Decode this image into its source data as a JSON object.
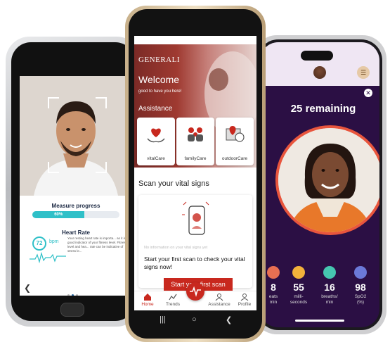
{
  "left_phone": {
    "measure_title": "Measure progress",
    "progress_label": "60%",
    "progress_fraction": 0.6,
    "heart_rate_title": "Heart Rate",
    "bpm_value": "72",
    "bpm_unit": "bpm",
    "hr_description": "Your resting heart rate is importa... as it is a good indicator of your fitness level. Fitness level and hea... rate can be indicative of stress le...",
    "back_glyph": "❮"
  },
  "center_phone": {
    "status_time": "09:54",
    "status_icons": "▣ ✈ ◔ ▮",
    "logo": "GENERALI",
    "welcome_title": "Welcome",
    "welcome_subtitle": "good to have you here!",
    "assistance_title": "Assistance",
    "cards": [
      {
        "label": "vitalCare"
      },
      {
        "label": "familyCare"
      },
      {
        "label": "outdoorCare"
      }
    ],
    "scan_title": "Scan your vital signs",
    "no_info": "No information on your vital signs yet",
    "scan_desc": "Start your first scan to check your vital signs now!",
    "start_button": "Start your first scan",
    "nav": {
      "home": "Home",
      "trends": "Trends",
      "assistance": "Assistance",
      "profile": "Profile"
    },
    "android_nav": {
      "recents": "|||",
      "home": "○",
      "back": "❮"
    }
  },
  "right_phone": {
    "remaining": "25 remaining",
    "close_glyph": "✕",
    "menu_glyph": "☰",
    "stats": [
      {
        "value": "8",
        "label": "eats\nmin",
        "color": "#e86f52"
      },
      {
        "value": "55",
        "label": "milli-\nseconds",
        "color": "#f2b23b"
      },
      {
        "value": "16",
        "label": "breaths/\nmin",
        "color": "#46c6b0"
      },
      {
        "value": "98",
        "label": "SpO2\n(%)",
        "color": "#6b79d8"
      }
    ]
  },
  "colors": {
    "brand_red": "#c8281e",
    "teal": "#2fc0c8",
    "purple": "#2b0f44"
  }
}
